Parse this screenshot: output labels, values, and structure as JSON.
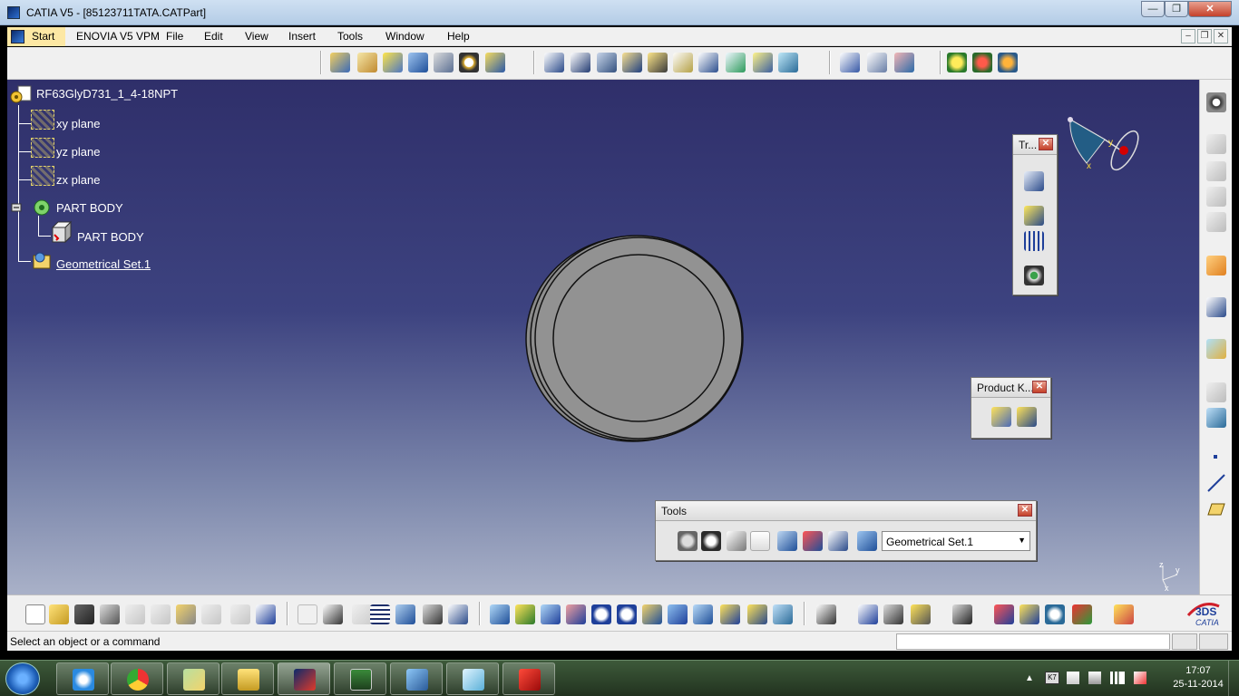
{
  "window": {
    "title": "CATIA V5 - [85123711TATA.CATPart]"
  },
  "menu": {
    "start": "Start",
    "items": [
      "ENOVIA V5 VPM",
      "File",
      "Edit",
      "View",
      "Insert",
      "Tools",
      "Window",
      "Help"
    ]
  },
  "tree": {
    "root": "RF63GlyD731_1_4-18NPT",
    "xy": "xy plane",
    "yz": "yz plane",
    "zx": "zx plane",
    "partbody": "PART BODY",
    "partbody_child": "PART BODY",
    "geoset": "Geometrical Set.1"
  },
  "panels": {
    "transform": {
      "title": "Tr..."
    },
    "product": {
      "title": "Product K..."
    },
    "tools": {
      "title": "Tools",
      "select_value": "Geometrical Set.1"
    }
  },
  "compass": {
    "x_label": "x",
    "y_label": "y"
  },
  "axis": {
    "x": "x",
    "y": "y",
    "z": "z"
  },
  "logo": {
    "text": "CATIA"
  },
  "status": {
    "message": "Select an object or a command"
  },
  "taskbar": {
    "time": "17:07",
    "date": "25-11-2014",
    "apps": [
      "internet-explorer",
      "chrome",
      "explorer-folder",
      "file-explorer",
      "catia",
      "task-monitor",
      "picture-viewer",
      "notes-app",
      "autocad"
    ]
  },
  "colors": {
    "viewport_top": "#2f2f6a",
    "viewport_bottom": "#a9b1c8",
    "part_fill": "#8e8e8e",
    "start_highlight": "#fde8a4"
  }
}
